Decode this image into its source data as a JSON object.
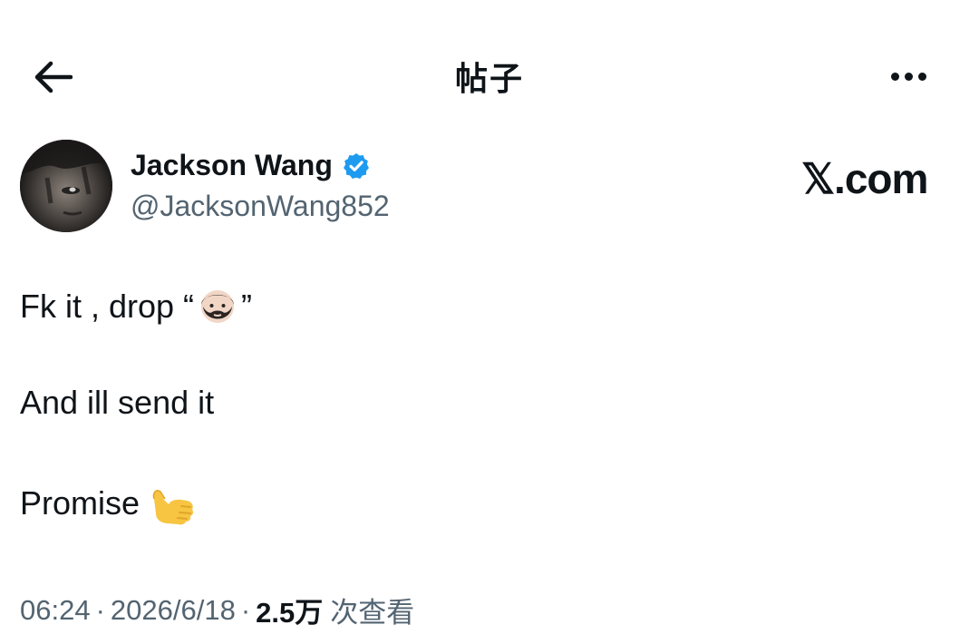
{
  "header": {
    "back_icon": "arrow-left-icon",
    "title": "帖子",
    "more_icon": "more-horizontal-icon"
  },
  "author": {
    "display_name": "Jackson Wang",
    "handle": "@JacksonWang852",
    "verified": true,
    "verified_color": "#1d9bf0",
    "avatar_icon": "avatar-image"
  },
  "watermark": {
    "text": "𝕏.com"
  },
  "tweet": {
    "line1_text": "Fk it , drop “",
    "line1_emoji": "man-beard-emoji",
    "line1_close": "”",
    "line2_text": "And ill send it",
    "line3_text": "Promise",
    "line3_emoji": "call-me-hand-emoji"
  },
  "meta": {
    "time": "06:24",
    "separator": "·",
    "date": "2026/6/18",
    "views_count": "2.5万",
    "views_label": "次查看"
  },
  "colors": {
    "text_primary": "#0f1419",
    "text_secondary": "#536471",
    "accent": "#1d9bf0"
  }
}
